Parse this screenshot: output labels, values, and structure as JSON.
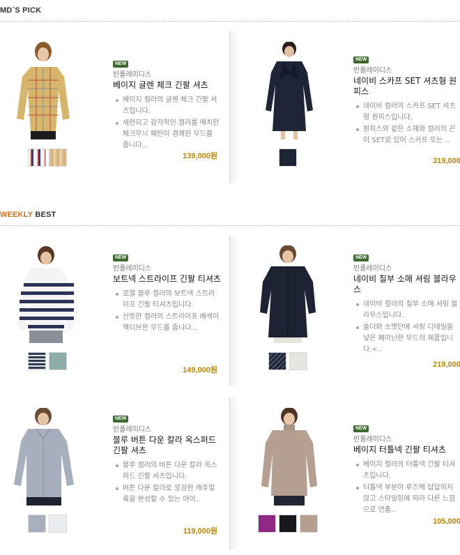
{
  "sections": {
    "md_pick": {
      "title_a": "MD`S",
      "title_b": " PICK"
    },
    "weekly_best": {
      "title_a": "WEEKLY",
      "title_b": " BEST"
    }
  },
  "products": [
    {
      "badge": "NEW",
      "brand": "빈폴레이디스",
      "name": "베이지 글렌 체크 긴팔 셔츠",
      "bullets": [
        "베이지 컬러의 글렌 체크 긴팔 셔츠입니다.",
        "세련되고 감각적인 컬러를 매치한 체크무늬 패턴이 경쾌한 무드를 줍니다.."
      ],
      "price": "139,000원",
      "swatch_colors": [
        "#6b3b3b",
        "#d9b98a"
      ]
    },
    {
      "badge": "NEW",
      "brand": "빈폴레이디스",
      "name": "네이비 스카프 SET 셔츠형 원피스",
      "bullets": [
        "네이비 컬러의 스카프 SET 셔츠형 원피스입니다.",
        "원피스와 같은 소재와 컬러의 끈이 SET로 있어 스카프 또는 .."
      ],
      "price": "319,000원",
      "swatch_colors": [
        "#1c2433"
      ]
    },
    {
      "badge": "NEW",
      "brand": "빈폴레이디스",
      "name": "보트넥 스트라이프 긴팔 티셔츠",
      "bullets": [
        "로열 블루 컬러의 보트넥 스트라이프 긴팔 티셔츠입니다.",
        "산뜻한 컬러의 스트라이프 배색이 액티브한 무드를 줍니다..."
      ],
      "price": "149,000원",
      "swatch_colors": [
        "#2f3a55",
        "#7fb0ab"
      ]
    },
    {
      "badge": "NEW",
      "brand": "빈폴레이디스",
      "name": "네이비 칠부 소매 셔링 블라우스",
      "bullets": [
        "네이비 컬러의 칠부 소매 셔링 블라우스입니다.",
        "숄더와 소맷단에 셔링 디테일을 넣은 페미닌한 무드의 제품입니다.<.."
      ],
      "price": "219,000원",
      "swatch_colors": [
        "#1d2333",
        "#e7e5e0"
      ]
    },
    {
      "badge": "NEW",
      "brand": "빈폴레이디스",
      "name": "블루 버튼 다운 칼라 옥스퍼드 긴팔 셔츠",
      "bullets": [
        "블루 컬러의 버튼 다운 칼라 옥스퍼드 긴팔 셔츠입니다.",
        "버튼 다운 칼라로 깔끔한 캐주얼룩을 완성할 수 있는 아이.."
      ],
      "price": "119,000원",
      "swatch_colors": [
        "#a7aebd",
        "#e9ecf1"
      ]
    },
    {
      "badge": "NEW",
      "brand": "빈폴레이디스",
      "name": "베이지 터틀넥 긴팔 티셔츠",
      "bullets": [
        "베이지 컬러의 터틀넥 긴팔 티셔츠입니다.",
        "터틀넥 부분이 루즈해 답답하지 않고 스타일링에 따라 다른 느낌으로 연출.."
      ],
      "price": "105,000원",
      "swatch_colors": [
        "#8e2a86",
        "#17181d",
        "#b49f91"
      ]
    }
  ]
}
